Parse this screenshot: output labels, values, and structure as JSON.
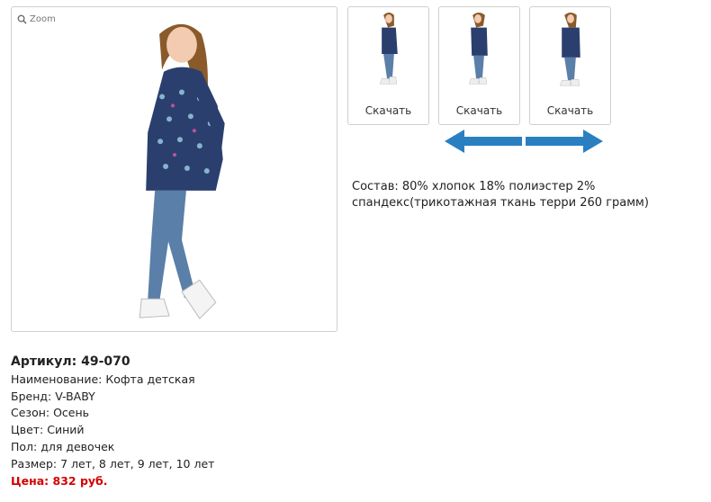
{
  "gallery": {
    "zoom_label": "Zoom",
    "thumbnails": [
      {
        "download_label": "Скачать"
      },
      {
        "download_label": "Скачать"
      },
      {
        "download_label": "Скачать"
      }
    ]
  },
  "composition": "Состав: 80% хлопок 18% полиэстер 2% спандекс(трикотажная ткань терри 260 грамм)",
  "product": {
    "sku": "Артикул: 49-070",
    "name": "Наименование: Кофта детская",
    "brand": "Бренд: V-BABY",
    "season": "Сезон: Осень",
    "color": "Цвет: Синий",
    "gender": "Пол: для девочек",
    "sizes": "Размер: 7 лет, 8 лет, 9 лет, 10 лет",
    "price": "Цена: 832 руб."
  },
  "colors": {
    "jacket": "#2b3f6e",
    "jeans": "#5a7fa8",
    "arrow": "#2a7fc1",
    "price": "#d40000"
  }
}
